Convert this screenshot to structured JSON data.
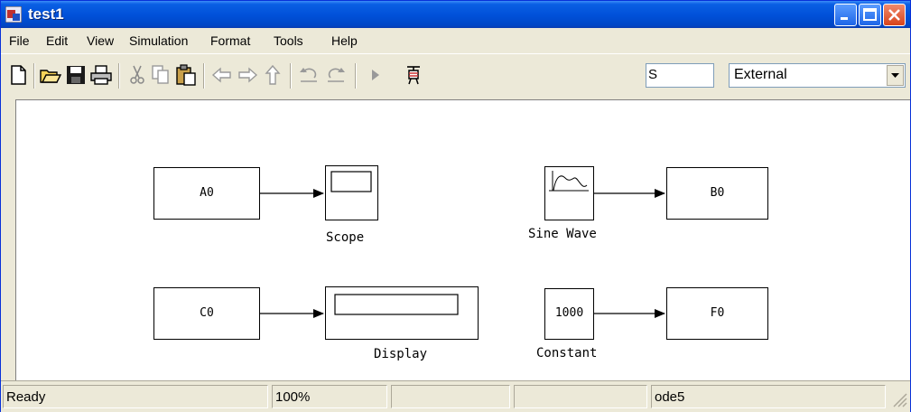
{
  "window": {
    "title": "test1"
  },
  "menu": [
    "File",
    "Edit",
    "View",
    "Simulation",
    "Format",
    "Tools",
    "Help"
  ],
  "toolbar": {
    "stop_time": "S",
    "sim_mode": "External"
  },
  "blocks": {
    "a0": {
      "label": "A0"
    },
    "scope": {
      "label": "Scope"
    },
    "sine": {
      "label": "Sine Wave"
    },
    "b0": {
      "label": "B0"
    },
    "c0": {
      "label": "C0"
    },
    "display": {
      "label": "Display"
    },
    "constant": {
      "label": "Constant",
      "value": "1000"
    },
    "f0": {
      "label": "F0"
    }
  },
  "status": {
    "state": "Ready",
    "zoom": "100%",
    "pane3": "",
    "pane4": "",
    "solver": "ode5"
  },
  "colors": {
    "title_blue": "#0050d8",
    "chrome": "#ece9d8",
    "close_red": "#d7431b"
  },
  "icons": [
    "new-model-icon",
    "open-icon",
    "save-icon",
    "print-icon",
    "cut-icon",
    "copy-icon",
    "paste-icon",
    "back-icon",
    "forward-icon",
    "up-icon",
    "undo-icon",
    "redo-icon",
    "start-simulation-icon",
    "build-icon"
  ]
}
